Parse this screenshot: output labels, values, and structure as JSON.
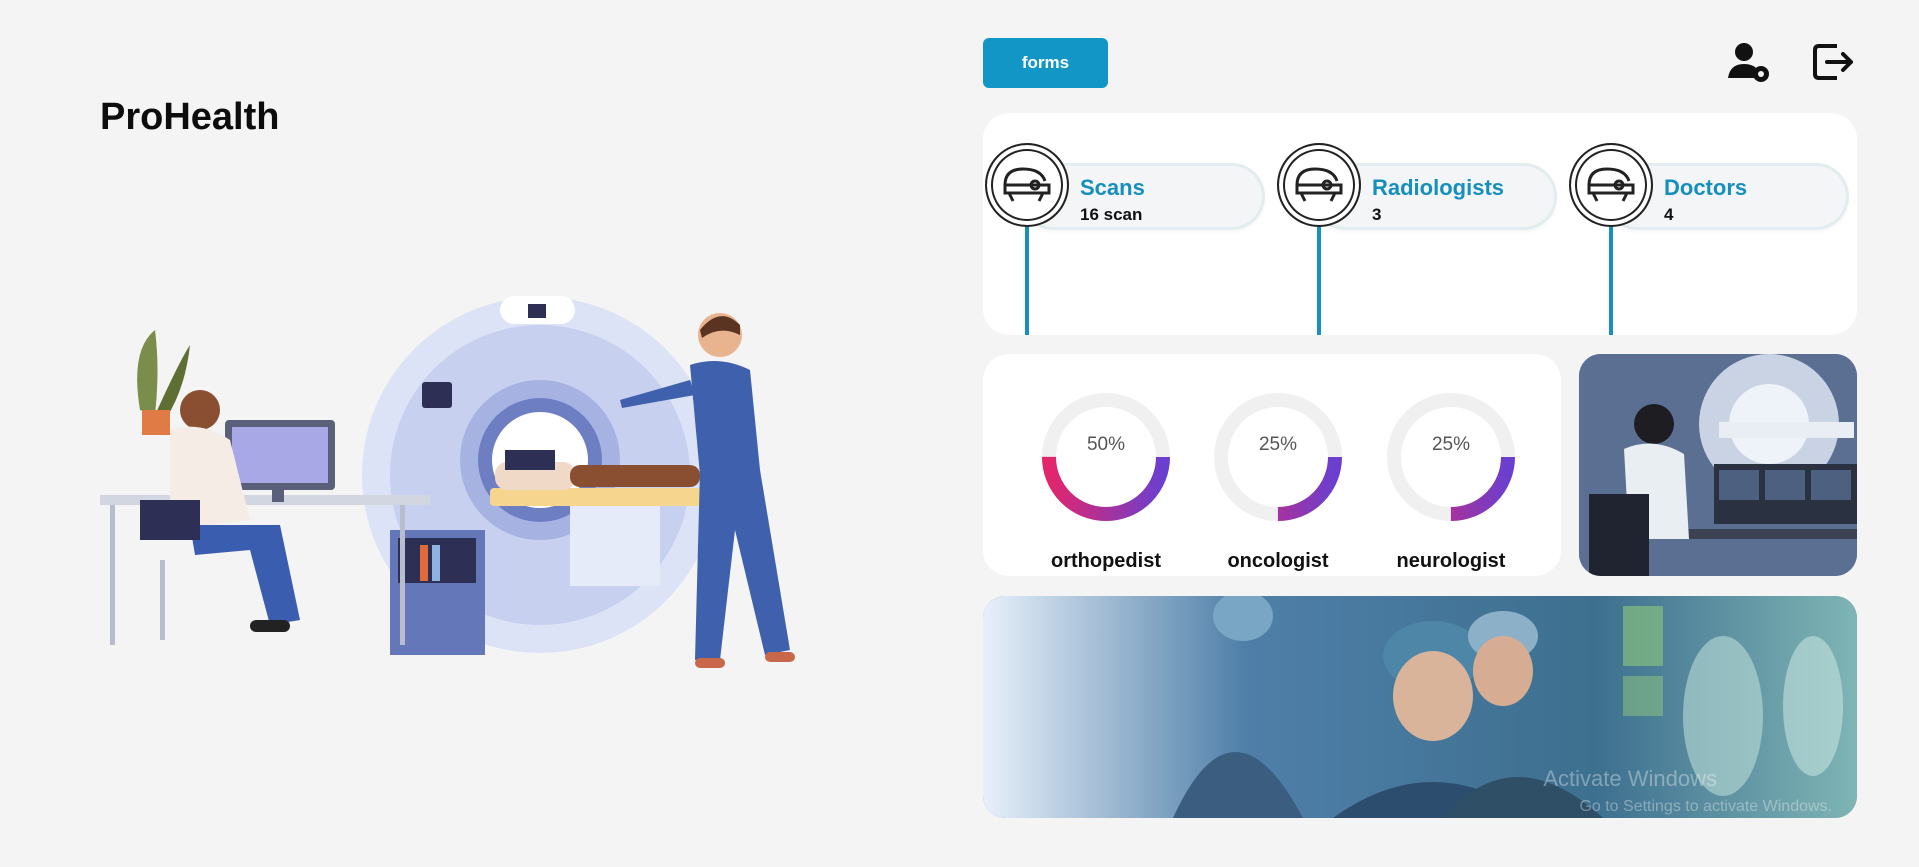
{
  "app": {
    "title": "ProHealth"
  },
  "toolbar": {
    "forms_label": "forms"
  },
  "icons": {
    "user_settings": "user-settings-icon",
    "logout": "logout-icon",
    "scanner": "mri-scanner-icon"
  },
  "colors": {
    "accent": "#1296c6",
    "donut_start": "#e3256b",
    "donut_end": "#6a3fcf",
    "background": "#f4f4f4"
  },
  "stats": [
    {
      "title": "Scans",
      "value": "16 scan"
    },
    {
      "title": "Radiologists",
      "value": "3"
    },
    {
      "title": "Doctors",
      "value": "4"
    }
  ],
  "specialties": [
    {
      "label": "orthopedist",
      "percent_text": "50%",
      "percent": 50
    },
    {
      "label": "oncologist",
      "percent_text": "25%",
      "percent": 25
    },
    {
      "label": "neurologist",
      "percent_text": "25%",
      "percent": 25
    }
  ],
  "watermark": {
    "line1": "Activate Windows",
    "line2": "Go to Settings to activate Windows."
  }
}
